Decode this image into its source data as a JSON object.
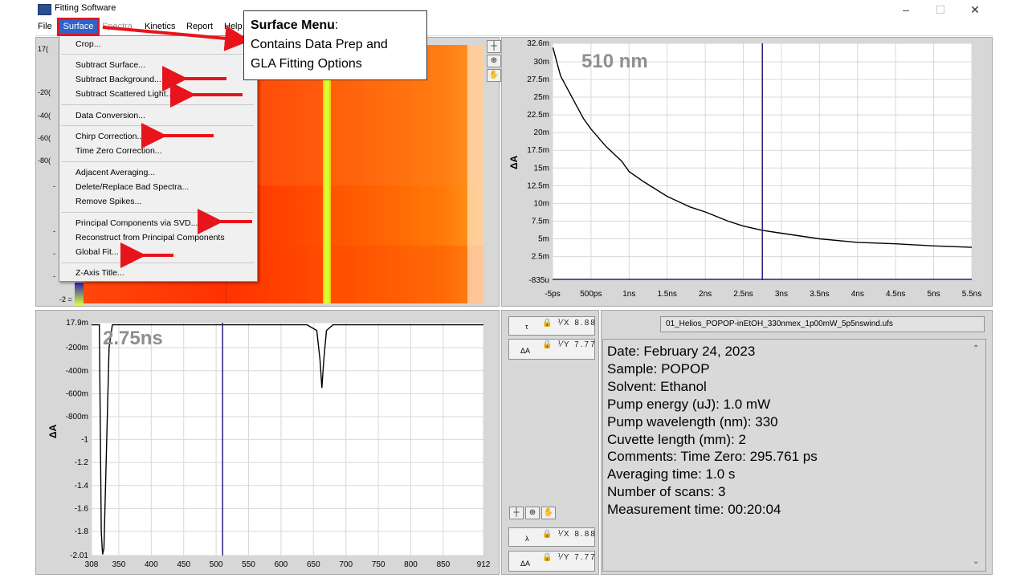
{
  "window": {
    "title": "Fitting Software",
    "controls": [
      "–",
      "☐",
      "✕"
    ]
  },
  "menubar": {
    "items": [
      "File",
      "Surface",
      "Spectra",
      "Kinetics",
      "Report",
      "Help"
    ],
    "active": "Surface"
  },
  "surface_menu": {
    "items": [
      "Crop...",
      "Subtract Surface...",
      "Subtract Background...",
      "Subtract Scattered Light...",
      "Data Conversion...",
      "Chirp Correction...",
      "Time Zero Correction...",
      "Adjacent Averaging...",
      "Delete/Replace Bad Spectra...",
      "Remove Spikes...",
      "Principal Components via SVD...",
      "Reconstruct from Principal Components",
      "Global Fit...",
      "Z-Axis Title..."
    ]
  },
  "callout": {
    "title": "Surface Menu",
    "colon": ":",
    "body_line1": "Contains Data Prep and",
    "body_line2": "GLA Fitting Options"
  },
  "heatmap": {
    "ytick_partial": [
      "17(",
      "-20(",
      "-40(",
      "-60(",
      "-80(",
      "-",
      "-",
      "-",
      "-",
      "-2 ="
    ],
    "tool_icons": [
      "cursor-move-icon",
      "zoom-icon",
      "hand-pan-icon"
    ],
    "colors": {
      "low": "#ff2a00",
      "mid": "#ff6a00",
      "high": "#ffbf00",
      "line": "#d4ff3a"
    }
  },
  "decay_chart": {
    "annotation": "510 nm",
    "ylabel": "ΔA",
    "cursor_x": "2.75ns"
  },
  "spectrum_chart": {
    "annotation": "2.75ns",
    "ylabel": "ΔA",
    "cursor_x": "510"
  },
  "chart_data": [
    {
      "type": "line",
      "title": "510 nm",
      "xlabel": "",
      "ylabel": "ΔA",
      "x_ticks": [
        "-5ps",
        "500ps",
        "1ns",
        "1.5ns",
        "2ns",
        "2.5ns",
        "3ns",
        "3.5ns",
        "4ns",
        "4.5ns",
        "5ns",
        "5.5ns"
      ],
      "y_ticks": [
        "32.6m",
        "30m",
        "27.5m",
        "25m",
        "22.5m",
        "20m",
        "17.5m",
        "15m",
        "12.5m",
        "10m",
        "7.5m",
        "5m",
        "2.5m",
        "-835u"
      ],
      "xlim": [
        -0.005,
        5.5
      ],
      "ylim": [
        -0.000835,
        0.0326
      ],
      "grid": true,
      "series": [
        {
          "x": [
            0.0,
            0.05,
            0.1,
            0.2,
            0.3,
            0.4,
            0.5,
            0.7,
            0.9,
            1.0,
            1.2,
            1.5,
            1.8,
            2.0,
            2.3,
            2.5,
            2.75,
            3.0,
            3.5,
            4.0,
            4.5,
            5.0,
            5.5
          ],
          "y": [
            0.032,
            0.03,
            0.028,
            0.026,
            0.024,
            0.022,
            0.0205,
            0.018,
            0.016,
            0.0145,
            0.013,
            0.011,
            0.0095,
            0.0088,
            0.0075,
            0.0068,
            0.0062,
            0.0058,
            0.005,
            0.0045,
            0.0043,
            0.004,
            0.0038
          ]
        }
      ],
      "cursor_x": 2.75
    },
    {
      "type": "line",
      "title": "2.75ns",
      "xlabel": "",
      "ylabel": "ΔA",
      "x_ticks": [
        "308",
        "350",
        "400",
        "450",
        "500",
        "550",
        "600",
        "650",
        "700",
        "750",
        "800",
        "850",
        "912"
      ],
      "x_tick_values": [
        308,
        350,
        400,
        450,
        500,
        550,
        600,
        650,
        700,
        750,
        800,
        850,
        912
      ],
      "y_ticks": [
        "17.9m",
        "-200m",
        "-400m",
        "-600m",
        "-800m",
        "-1",
        "-1.2",
        "-1.4",
        "-1.6",
        "-1.8",
        "-2.01"
      ],
      "y_tick_values": [
        0.0179,
        -0.2,
        -0.4,
        -0.6,
        -0.8,
        -1.0,
        -1.2,
        -1.4,
        -1.6,
        -1.8,
        -2.01
      ],
      "xlim": [
        308,
        912
      ],
      "ylim": [
        -2.01,
        0.0179
      ],
      "grid": true,
      "series": [
        {
          "x": [
            308,
            320,
            321,
            322,
            323,
            325,
            327,
            330,
            335,
            340,
            400,
            500,
            600,
            640,
            655,
            660,
            663,
            666,
            670,
            680,
            700,
            800,
            912
          ],
          "y": [
            0,
            0,
            -0.6,
            -1.2,
            -1.8,
            -2.0,
            -1.95,
            -1.3,
            -0.2,
            0,
            0,
            0,
            0,
            0,
            -0.05,
            -0.3,
            -0.55,
            -0.3,
            -0.05,
            0,
            0,
            0,
            0
          ]
        }
      ],
      "cursor_x": 510
    }
  ],
  "controls": {
    "tau_label": "τ",
    "dA_label_1": "ΔA",
    "lambda_label": "λ",
    "dA_label_2": "ΔA",
    "icon_row": "🔒 ⅟X 8.88",
    "icon_row_y": "🔒 ⅟Y 7.77",
    "tool_icons": [
      "cursor-move-icon",
      "zoom-icon",
      "hand-pan-icon"
    ]
  },
  "info": {
    "filename": "01_Helios_POPOP-inEtOH_330nmex_1p00mW_5p5nswind.ufs",
    "lines": [
      "Date: February 24, 2023",
      "Sample: POPOP",
      "Solvent: Ethanol",
      "Pump energy (uJ): 1.0 mW",
      "Pump wavelength (nm): 330",
      "Cuvette length (mm): 2",
      "Comments: Time Zero: 295.761 ps",
      "Averaging time: 1.0 s",
      "Number of scans: 3",
      "Measurement time: 00:20:04"
    ]
  },
  "colors": {
    "menu_highlight": "#2f63c9",
    "annotation_red": "#e8141c",
    "cursor_line": "#2a1f7a"
  }
}
